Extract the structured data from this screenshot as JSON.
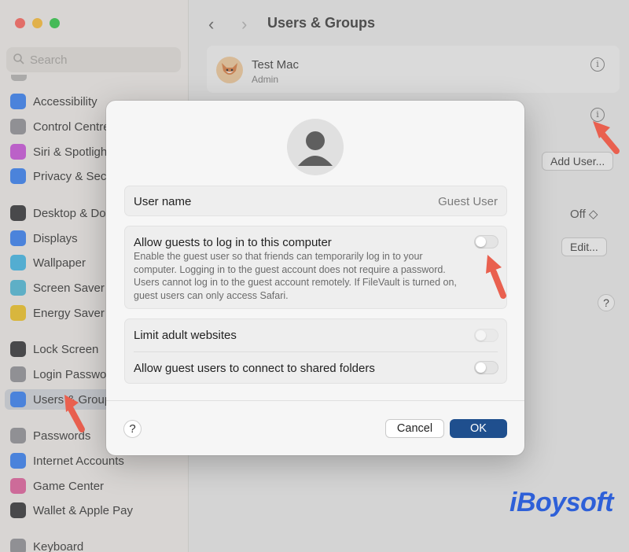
{
  "window": {
    "title": "Users & Groups",
    "nav_back": "‹",
    "nav_forward": "›"
  },
  "sidebar": {
    "search_placeholder": "Search",
    "items": [
      {
        "label": "Accessibility",
        "icon": "accessibility-icon",
        "color": "#2f7cf6"
      },
      {
        "label": "Control Centre",
        "icon": "control-centre-icon",
        "color": "#8e8e93"
      },
      {
        "label": "Siri & Spotlight",
        "icon": "siri-icon",
        "color": "#c94ddb"
      },
      {
        "label": "Privacy & Security",
        "icon": "privacy-hand-icon",
        "color": "#2f7cf6"
      },
      {
        "label": "Desktop & Dock",
        "icon": "desktop-dock-icon",
        "color": "#2c2c2e"
      },
      {
        "label": "Displays",
        "icon": "displays-icon",
        "color": "#2f7cf6"
      },
      {
        "label": "Wallpaper",
        "icon": "wallpaper-icon",
        "color": "#39b6e8"
      },
      {
        "label": "Screen Saver",
        "icon": "screen-saver-icon",
        "color": "#48b9d9"
      },
      {
        "label": "Energy Saver",
        "icon": "energy-saver-icon",
        "color": "#f2c21b"
      },
      {
        "label": "Lock Screen",
        "icon": "lock-screen-icon",
        "color": "#2c2c2e"
      },
      {
        "label": "Login Password",
        "icon": "login-password-icon",
        "color": "#8e8e93"
      },
      {
        "label": "Users & Groups",
        "icon": "users-groups-icon",
        "color": "#2f7cf6"
      },
      {
        "label": "Passwords",
        "icon": "passwords-key-icon",
        "color": "#8e8e93"
      },
      {
        "label": "Internet Accounts",
        "icon": "internet-accounts-icon",
        "color": "#2f7cf6"
      },
      {
        "label": "Game Center",
        "icon": "game-center-icon",
        "color": "#e25a9a"
      },
      {
        "label": "Wallet & Apple Pay",
        "icon": "wallet-icon",
        "color": "#2c2c2e"
      },
      {
        "label": "Keyboard",
        "icon": "keyboard-icon",
        "color": "#8e8e93"
      }
    ]
  },
  "main": {
    "current_user_name": "Test Mac",
    "current_user_role": "Admin",
    "add_user_label": "Add User...",
    "off_label": "Off ◇",
    "edit_label": "Edit...",
    "help_label": "?"
  },
  "dialog": {
    "user_name_label": "User name",
    "user_name_value": "Guest User",
    "allow_guests_label": "Allow guests to log in to this computer",
    "allow_guests_desc": "Enable the guest user so that friends can temporarily log in to your computer. Logging in to the guest account does not require a password. Users cannot log in to the guest account remotely. If FileVault is turned on, guest users can only access Safari.",
    "allow_guests_on": false,
    "limit_websites_label": "Limit adult websites",
    "limit_websites_on": false,
    "shared_folders_label": "Allow guest users to connect to shared folders",
    "shared_folders_on": false,
    "help_label": "?",
    "cancel_label": "Cancel",
    "ok_label": "OK"
  },
  "watermark": "iBoysoft",
  "colors": {
    "accent": "#1f4f8e",
    "annotation_arrow": "#e9604f"
  }
}
